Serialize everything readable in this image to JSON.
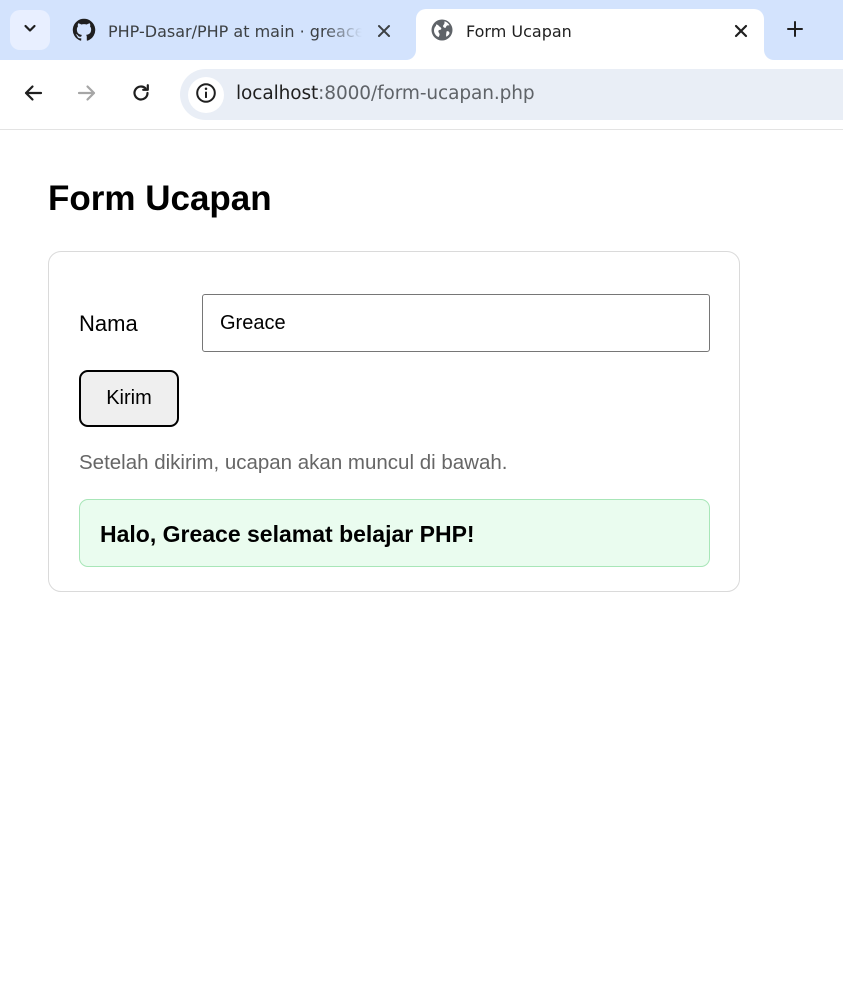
{
  "browser": {
    "tabs": [
      {
        "title": "PHP-Dasar/PHP at main · greace",
        "favicon": "github-icon",
        "active": false
      },
      {
        "title": "Form Ucapan",
        "favicon": "globe-icon",
        "active": true
      }
    ],
    "address_bar": {
      "host": "localhost",
      "rest": ":8000/form-ucapan.php"
    }
  },
  "page": {
    "title": "Form Ucapan",
    "form": {
      "name_label": "Nama",
      "name_value": "Greace",
      "submit_label": "Kirim"
    },
    "hint": "Setelah dikirim, ucapan akan muncul di bawah.",
    "greeting": "Halo, Greace selamat belajar PHP!"
  },
  "colors": {
    "tabstrip": "#d3e3fd",
    "omnibox": "#e9eef6",
    "greeting_bg": "#eafcef",
    "greeting_border": "#a8e6b8",
    "hint_text": "#666666"
  }
}
